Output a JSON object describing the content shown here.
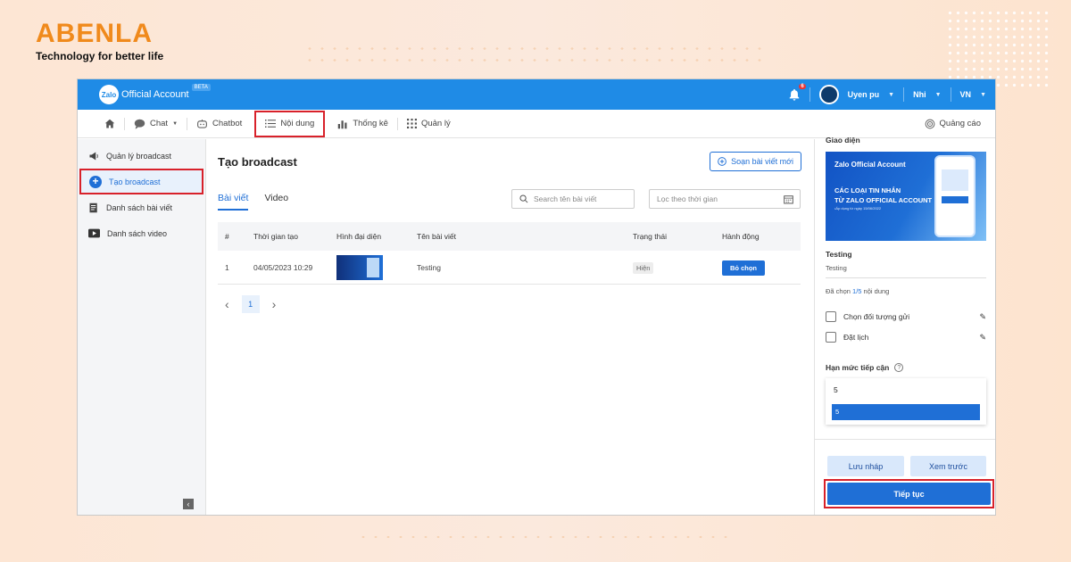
{
  "brand": {
    "name": "ABENLA",
    "tagline": "Technology for better life"
  },
  "topbar": {
    "logo": "Zalo",
    "title": "Official Account",
    "beta": "BETA",
    "notifications": "6",
    "user": "Uyen pu",
    "role": "Nhi",
    "lang": "VN"
  },
  "menu": {
    "items": [
      {
        "label": "Chat",
        "icon": "chat-icon"
      },
      {
        "label": "Chatbot",
        "icon": "chatbot-icon"
      },
      {
        "label": "Nội dung",
        "icon": "list-icon"
      },
      {
        "label": "Thống kê",
        "icon": "chart-icon"
      },
      {
        "label": "Quản lý",
        "icon": "grid-icon"
      }
    ],
    "right": "Quảng cáo"
  },
  "sidebar": {
    "items": [
      {
        "label": "Quản lý broadcast",
        "icon": "megaphone-icon"
      },
      {
        "label": "Tạo broadcast",
        "icon": "plus-circle-icon"
      },
      {
        "label": "Danh sách bài viết",
        "icon": "article-icon"
      },
      {
        "label": "Danh sách video",
        "icon": "video-icon"
      }
    ]
  },
  "main": {
    "title": "Tạo broadcast",
    "new_button": "Soạn bài viết mới",
    "tabs": [
      "Bài viết",
      "Video"
    ],
    "search_placeholder": "Search tên bài viết",
    "filter_placeholder": "Lọc theo thời gian",
    "columns": [
      "#",
      "Thời gian tạo",
      "Hình đại diện",
      "Tên bài viết",
      "Trạng thái",
      "Hành động"
    ],
    "rows": [
      {
        "index": "1",
        "created": "04/05/2023 10:29",
        "name": "Testing",
        "status": "Hiện",
        "action": "Bỏ chọn"
      }
    ],
    "pager": {
      "prev": "‹",
      "page": "1",
      "next": "›"
    }
  },
  "panel": {
    "section_label": "Giao diện",
    "banner": {
      "logo": "Zalo Official Account",
      "headline_1": "CÁC LOẠI TIN NHẮN",
      "headline_2": "TỪ ZALO OFFICIAL ACCOUNT",
      "sub": "•Áp dụng từ ngày 15/06/2022"
    },
    "title": "Testing",
    "subtitle": "Testing",
    "selected_prefix": "Đã chọn ",
    "selected_count": "1/5",
    "selected_suffix": " nội dung",
    "options": [
      "Chọn đối tượng gửi",
      "Đặt lịch"
    ],
    "quota_label": "Hạn mức tiếp cận",
    "quota_value": "5",
    "quota_option": "5",
    "save_draft": "Lưu nháp",
    "preview": "Xem trước",
    "continue": "Tiếp tục"
  },
  "colors": {
    "brand_orange": "#f08a1c",
    "primary": "#1f6fd6",
    "highlight_red": "#d8212a",
    "topbar": "#1f8be6"
  }
}
